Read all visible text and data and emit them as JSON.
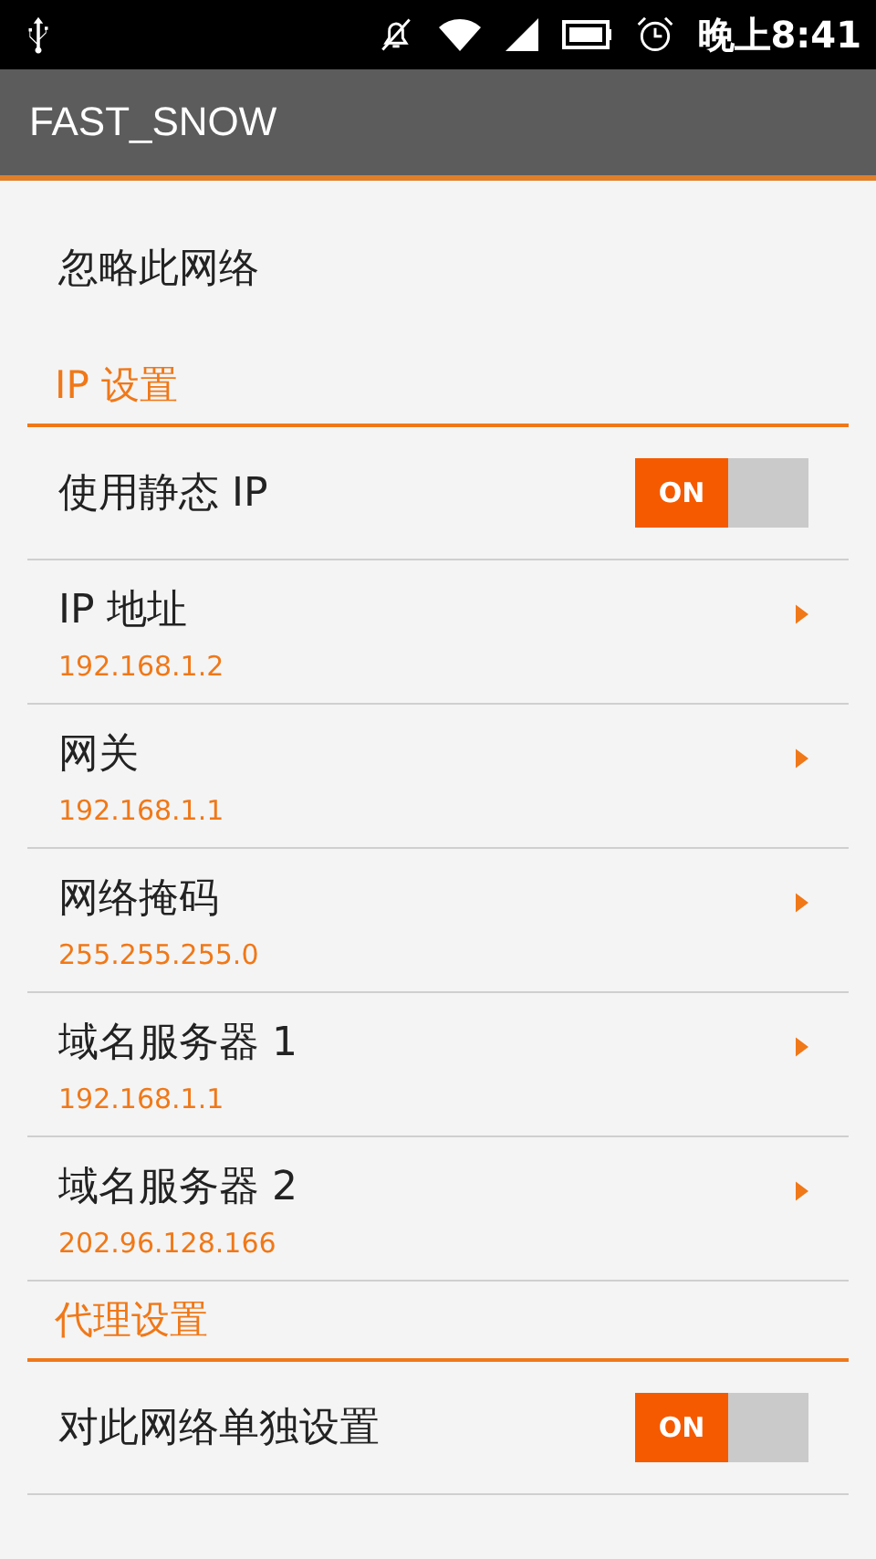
{
  "status_bar": {
    "time": "晚上8:41"
  },
  "app_bar": {
    "title": "FAST_SNOW"
  },
  "items": [
    {
      "kind": "action",
      "label": "忽略此网络"
    },
    {
      "kind": "header",
      "label": "IP 设置"
    },
    {
      "kind": "switch",
      "label": "使用静态 IP",
      "on": true,
      "switch_text": "ON"
    },
    {
      "kind": "value",
      "label": "IP 地址",
      "value": "192.168.1.2"
    },
    {
      "kind": "value",
      "label": "网关",
      "value": "192.168.1.1"
    },
    {
      "kind": "value",
      "label": "网络掩码",
      "value": "255.255.255.0"
    },
    {
      "kind": "value",
      "label": "域名服务器 1",
      "value": "192.168.1.1"
    },
    {
      "kind": "value",
      "label": "域名服务器 2",
      "value": "202.96.128.166"
    },
    {
      "kind": "header",
      "label": "代理设置"
    },
    {
      "kind": "switch",
      "label": "对此网络单独设置",
      "on": true,
      "switch_text": "ON"
    }
  ]
}
